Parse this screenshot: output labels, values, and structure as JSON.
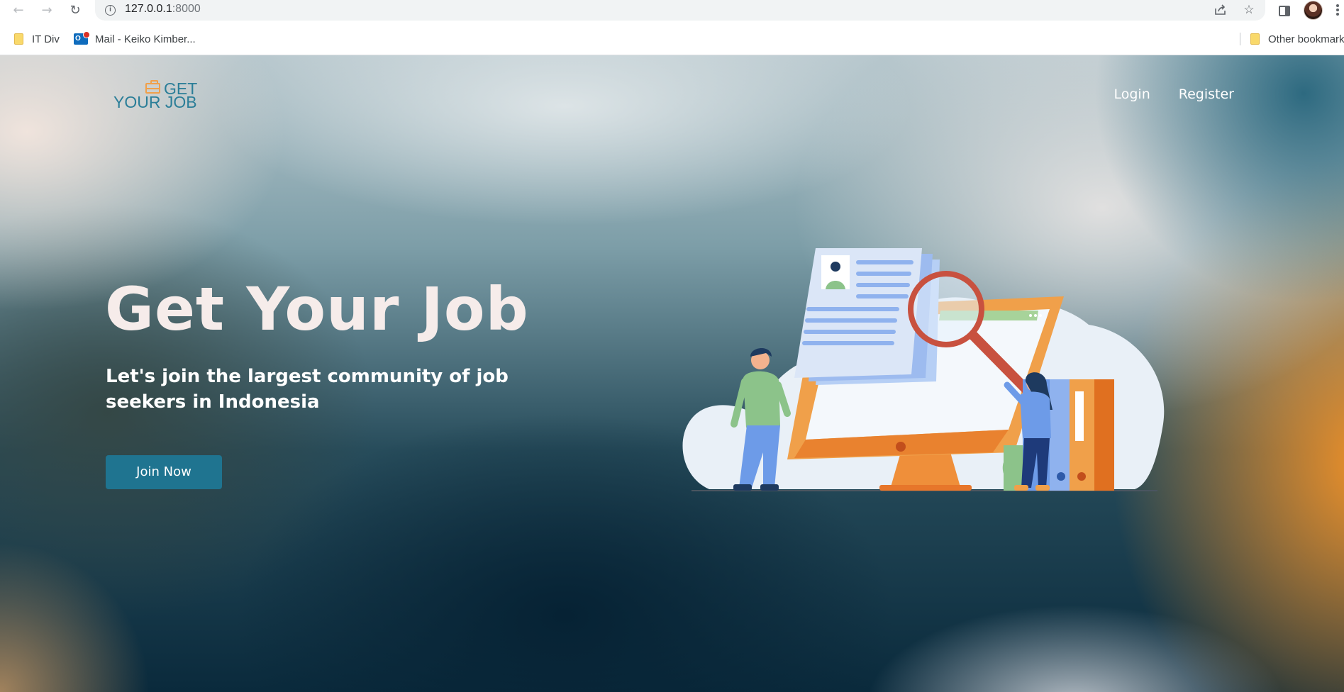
{
  "browser": {
    "url_host": "127.0.0.1",
    "url_port": ":8000",
    "bookmarks": [
      {
        "label": "IT Div",
        "icon": "folder-icon"
      },
      {
        "label": "Mail - Keiko Kimber...",
        "icon": "outlook-icon"
      }
    ],
    "other_bookmarks": "Other bookmarks"
  },
  "site": {
    "logo_line1": "GET",
    "logo_line2": "YOUR JOB",
    "nav": {
      "login": "Login",
      "register": "Register"
    }
  },
  "hero": {
    "title": "Get Your Job",
    "subtitle": "Let's join the largest community of job seekers in Indonesia",
    "cta": "Join Now"
  },
  "colors": {
    "brand_teal": "#1f7490",
    "accent_orange": "#f0a04a",
    "hero_title": "#f6ecea"
  }
}
